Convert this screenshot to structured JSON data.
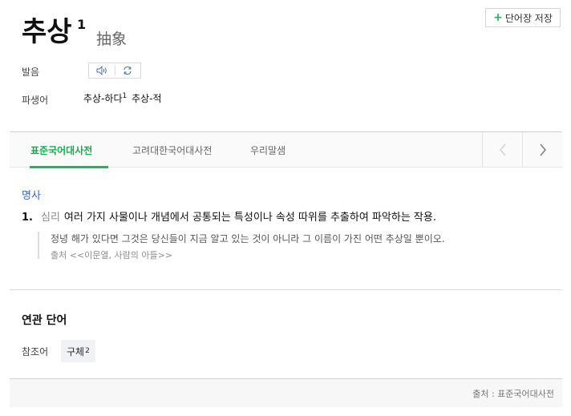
{
  "header": {
    "word": "추상",
    "homonym": "1",
    "hanja": "抽象",
    "save_button": {
      "icon": "plus-icon",
      "label": "단어장 저장"
    }
  },
  "pronunciation": {
    "label": "발음",
    "icons": [
      "speaker-icon",
      "repeat-icon"
    ]
  },
  "derivation": {
    "label": "파생어",
    "items": [
      {
        "text": "추상-하다",
        "sup": "1"
      },
      {
        "text": "추상-적",
        "sup": ""
      }
    ]
  },
  "tabs": [
    {
      "label": "표준국어대사전",
      "active": true
    },
    {
      "label": "고려대한국어대사전",
      "active": false
    },
    {
      "label": "우리말샘",
      "active": false
    }
  ],
  "nav_icons": [
    "chevron-left-icon",
    "chevron-right-icon"
  ],
  "definition": {
    "pos": "명사",
    "number": "1.",
    "field": "심리",
    "text": "여러 가지 사물이나 개념에서 공통되는 특성이나 속성 따위를 추출하여 파악하는 작용.",
    "example": "정녕 해가 있다면 그것은 당신들이 지금 알고 있는 것이 아니라 그 이름이 가진 어떤 추상일 뿐이오.",
    "example_source": "출처 <<이문열, 사람의 아들>>"
  },
  "related": {
    "title": "연관 단어",
    "ref_label": "참조어",
    "ref_word": "구체",
    "ref_sup": "2"
  },
  "footer": {
    "source": "출처 : 표준국어대사전"
  },
  "colors": {
    "accent": "#19b95a",
    "pos": "#3b6cb3"
  }
}
